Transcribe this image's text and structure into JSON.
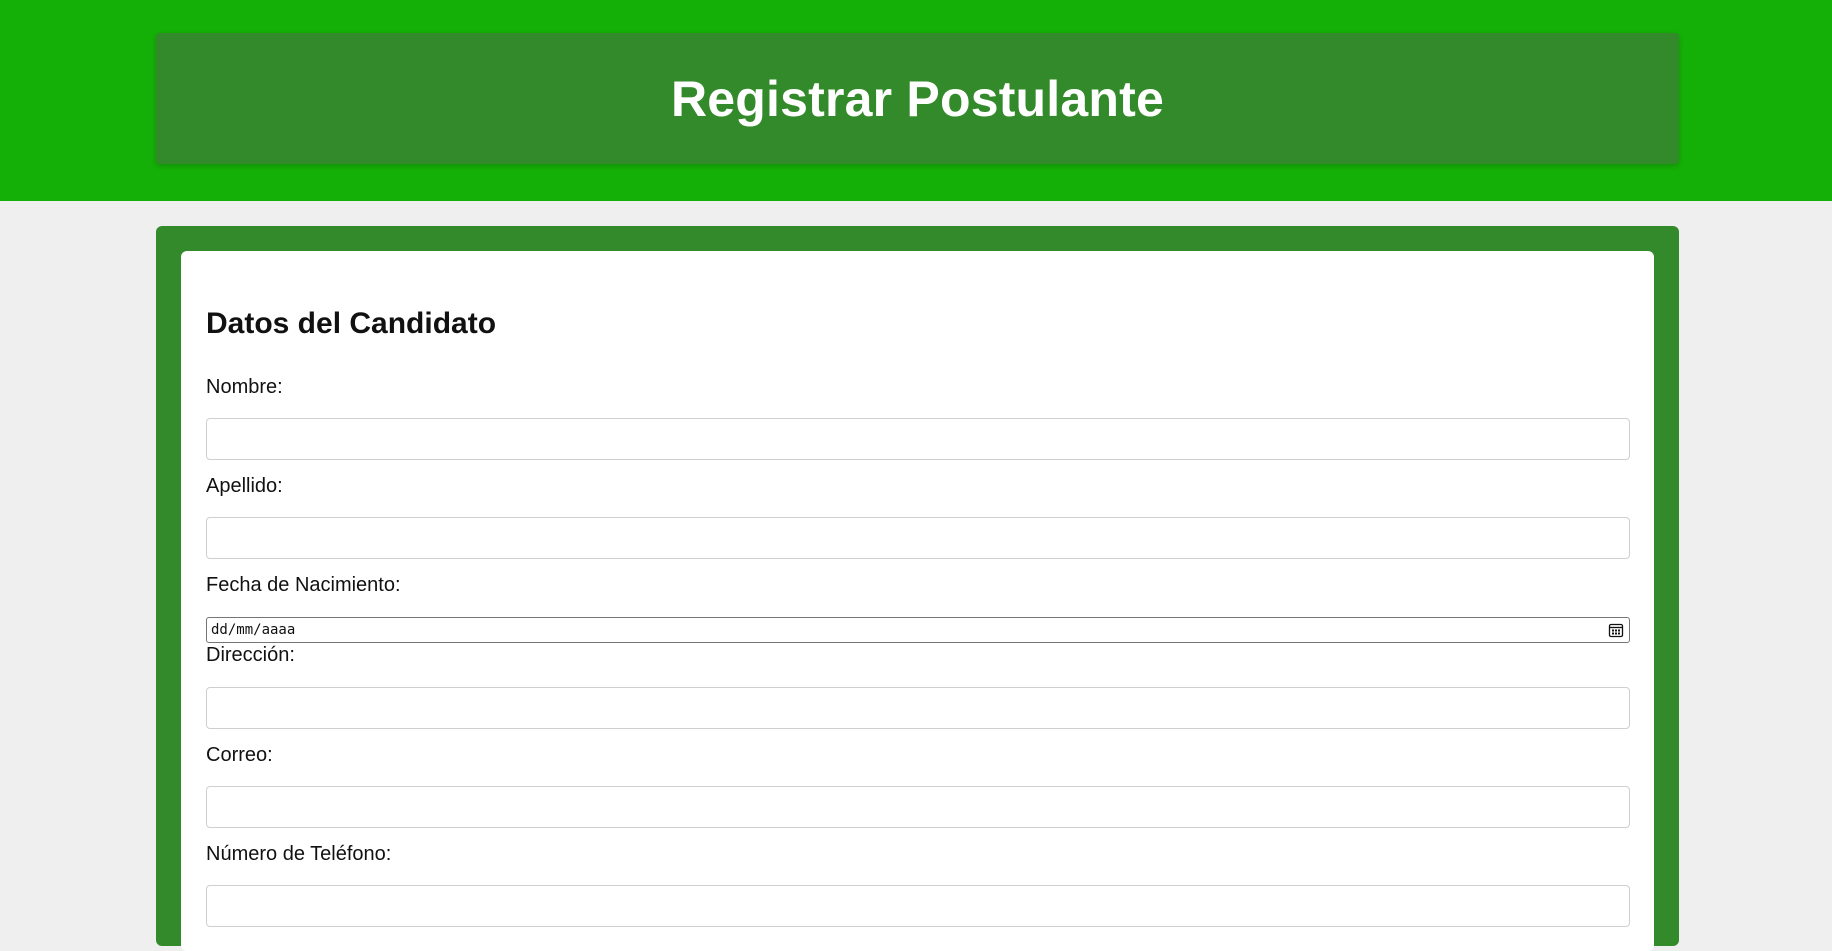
{
  "header": {
    "title": "Registrar Postulante"
  },
  "form": {
    "section_title": "Datos del Candidato",
    "fields": {
      "nombre": {
        "label": "Nombre:",
        "value": ""
      },
      "apellido": {
        "label": "Apellido:",
        "value": ""
      },
      "fecha_nacimiento": {
        "label": "Fecha de Nacimiento:",
        "placeholder": "dd/mm/aaaa"
      },
      "direccion": {
        "label": "Dirección:",
        "value": ""
      },
      "correo": {
        "label": "Correo:",
        "value": ""
      },
      "telefono": {
        "label": "Número de Teléfono:",
        "value": ""
      }
    }
  },
  "icons": {
    "date_picker": "calendar-icon"
  },
  "colors": {
    "topbar": "#15b007",
    "header_card": "#338a2a",
    "form_frame": "#338a2a",
    "page_background": "#efefef"
  }
}
